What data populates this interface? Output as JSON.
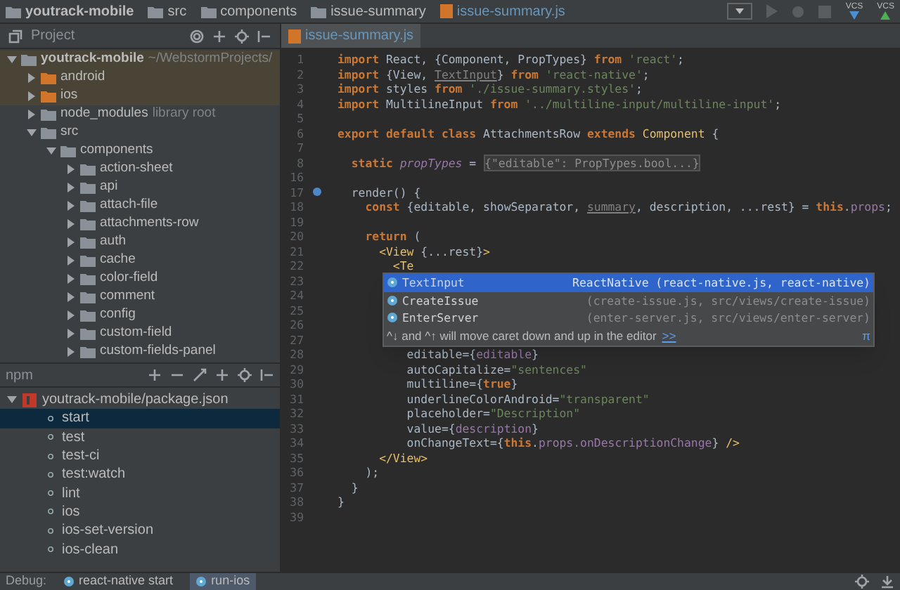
{
  "breadcrumbs": [
    {
      "label": "youtrack-mobile",
      "kind": "folder",
      "bold": true
    },
    {
      "label": "src",
      "kind": "folder",
      "bold": false
    },
    {
      "label": "components",
      "kind": "folder",
      "bold": false
    },
    {
      "label": "issue-summary",
      "kind": "folder",
      "bold": false
    },
    {
      "label": "issue-summary.js",
      "kind": "file",
      "bold": false
    }
  ],
  "toolbar": {
    "vcs_labels": [
      "VCS",
      "VCS"
    ]
  },
  "project_panel": {
    "title": "Project",
    "tree": [
      {
        "label": "youtrack-mobile",
        "hint": "~/WebstormProjects/",
        "expanded": true,
        "tinted": true,
        "bold": true,
        "color": "#8a9199",
        "children": [
          {
            "label": "android",
            "expanded": false,
            "tinted": true,
            "bold": false,
            "color": "#d0752a"
          },
          {
            "label": "ios",
            "expanded": false,
            "tinted": true,
            "bold": false,
            "color": "#d0752a"
          },
          {
            "label": "node_modules",
            "hint": "library root",
            "expanded": false,
            "tinted": false,
            "bold": false,
            "color": "#8a9199"
          },
          {
            "label": "src",
            "expanded": true,
            "tinted": false,
            "bold": false,
            "color": "#8a9199",
            "children": [
              {
                "label": "components",
                "expanded": true,
                "tinted": false,
                "bold": false,
                "color": "#8a9199",
                "children": [
                  {
                    "label": "action-sheet",
                    "expanded": false,
                    "tinted": false,
                    "bold": false,
                    "color": "#8a9199"
                  },
                  {
                    "label": "api",
                    "expanded": false,
                    "tinted": false,
                    "bold": false,
                    "color": "#8a9199"
                  },
                  {
                    "label": "attach-file",
                    "expanded": false,
                    "tinted": false,
                    "bold": false,
                    "color": "#8a9199"
                  },
                  {
                    "label": "attachments-row",
                    "expanded": false,
                    "tinted": false,
                    "bold": false,
                    "color": "#8a9199"
                  },
                  {
                    "label": "auth",
                    "expanded": false,
                    "tinted": false,
                    "bold": false,
                    "color": "#8a9199"
                  },
                  {
                    "label": "cache",
                    "expanded": false,
                    "tinted": false,
                    "bold": false,
                    "color": "#8a9199"
                  },
                  {
                    "label": "color-field",
                    "expanded": false,
                    "tinted": false,
                    "bold": false,
                    "color": "#8a9199"
                  },
                  {
                    "label": "comment",
                    "expanded": false,
                    "tinted": false,
                    "bold": false,
                    "color": "#8a9199"
                  },
                  {
                    "label": "config",
                    "expanded": false,
                    "tinted": false,
                    "bold": false,
                    "color": "#8a9199"
                  },
                  {
                    "label": "custom-field",
                    "expanded": false,
                    "tinted": false,
                    "bold": false,
                    "color": "#8a9199"
                  },
                  {
                    "label": "custom-fields-panel",
                    "expanded": false,
                    "tinted": false,
                    "bold": false,
                    "color": "#8a9199"
                  }
                ]
              }
            ]
          }
        ]
      }
    ]
  },
  "npm_panel": {
    "title": "npm",
    "package": {
      "label": "youtrack-mobile/package.json",
      "expanded": true,
      "scripts": [
        {
          "label": "start",
          "selected": true
        },
        {
          "label": "test",
          "selected": false
        },
        {
          "label": "test-ci",
          "selected": false
        },
        {
          "label": "test:watch",
          "selected": false
        },
        {
          "label": "lint",
          "selected": false
        },
        {
          "label": "ios",
          "selected": false
        },
        {
          "label": "ios-set-version",
          "selected": false
        },
        {
          "label": "ios-clean",
          "selected": false
        }
      ]
    }
  },
  "editor": {
    "tab": "issue-summary.js",
    "lines": [
      {
        "num": "1",
        "tokens": [
          {
            "kind": "kw",
            "text": "import"
          },
          {
            "kind": "plain",
            "text": " React, {Component, PropTypes} "
          },
          {
            "kind": "kw",
            "text": "from"
          },
          {
            "kind": "str",
            "text": " 'react'"
          },
          {
            "kind": "plain",
            "text": ";"
          }
        ]
      },
      {
        "num": "2",
        "tokens": [
          {
            "kind": "kw",
            "text": "import"
          },
          {
            "kind": "plain",
            "text": " {View, "
          },
          {
            "kind": "unused",
            "text": "TextInput"
          },
          {
            "kind": "plain",
            "text": "} "
          },
          {
            "kind": "kw",
            "text": "from"
          },
          {
            "kind": "str",
            "text": " 'react-native'"
          },
          {
            "kind": "plain",
            "text": ";"
          }
        ]
      },
      {
        "num": "3",
        "tokens": [
          {
            "kind": "kw",
            "text": "import"
          },
          {
            "kind": "plain",
            "text": " styles "
          },
          {
            "kind": "kw",
            "text": "from"
          },
          {
            "kind": "str",
            "text": " './issue-summary.styles'"
          },
          {
            "kind": "plain",
            "text": ";"
          }
        ]
      },
      {
        "num": "4",
        "tokens": [
          {
            "kind": "kw",
            "text": "import"
          },
          {
            "kind": "plain",
            "text": " MultilineInput "
          },
          {
            "kind": "kw",
            "text": "from"
          },
          {
            "kind": "str",
            "text": " '../multiline-input/multiline-input'"
          },
          {
            "kind": "plain",
            "text": ";"
          }
        ]
      },
      {
        "num": "5"
      },
      {
        "num": "6",
        "tokens": [
          {
            "kind": "kw",
            "text": "export default class"
          },
          {
            "kind": "plain",
            "text": " AttachmentsRow "
          },
          {
            "kind": "kw",
            "text": "extends "
          },
          {
            "kind": "tag",
            "text": "Component"
          },
          {
            "kind": "plain",
            "text": " {"
          }
        ]
      },
      {
        "num": "7"
      },
      {
        "num": "8",
        "tokens": [
          {
            "kind": "kw",
            "text": "  static "
          },
          {
            "kind": "field",
            "text": "propTypes"
          },
          {
            "kind": "plain",
            "text": " = "
          },
          {
            "kind": "folded",
            "text": "{\"editable\": PropTypes.bool...}"
          }
        ]
      },
      {
        "num": "16"
      },
      {
        "num": "17",
        "marker": true,
        "tokens": [
          {
            "kind": "plain",
            "text": "  render() {"
          }
        ]
      },
      {
        "num": "18",
        "tokens": [
          {
            "kind": "kw",
            "text": "    const"
          },
          {
            "kind": "plain",
            "text": " {editable, showSeparator, "
          },
          {
            "kind": "unused",
            "text": "summary"
          },
          {
            "kind": "plain",
            "text": ", description, ...rest} = "
          },
          {
            "kind": "kw",
            "text": "this"
          },
          {
            "kind": "plain",
            "text": "."
          },
          {
            "kind": "prop",
            "text": "props"
          },
          {
            "kind": "plain",
            "text": ";"
          }
        ]
      },
      {
        "num": "19"
      },
      {
        "num": "20",
        "tokens": [
          {
            "kind": "kw",
            "text": "    return"
          },
          {
            "kind": "plain",
            "text": " ("
          }
        ]
      },
      {
        "num": "21",
        "tokens": [
          {
            "kind": "tag",
            "text": "      <View"
          },
          {
            "kind": "plain",
            "text": " {...rest}"
          },
          {
            "kind": "tag",
            "text": ">"
          }
        ]
      },
      {
        "num": "22",
        "tokens": [
          {
            "kind": "tag",
            "text": "        <Te"
          }
        ]
      },
      {
        "num": "23"
      },
      {
        "num": "24"
      },
      {
        "num": "25"
      },
      {
        "num": "26"
      },
      {
        "num": "27"
      },
      {
        "num": "28",
        "tokens": [
          {
            "kind": "plain",
            "text": "          editable={"
          },
          {
            "kind": "prop",
            "text": "editable"
          },
          {
            "kind": "plain",
            "text": "}"
          }
        ]
      },
      {
        "num": "29",
        "tokens": [
          {
            "kind": "plain",
            "text": "          autoCapitalize="
          },
          {
            "kind": "str",
            "text": "\"sentences\""
          }
        ]
      },
      {
        "num": "30",
        "tokens": [
          {
            "kind": "plain",
            "text": "          multiline={"
          },
          {
            "kind": "kw",
            "text": "true"
          },
          {
            "kind": "plain",
            "text": "}"
          }
        ]
      },
      {
        "num": "31",
        "tokens": [
          {
            "kind": "plain",
            "text": "          underlineColorAndroid="
          },
          {
            "kind": "str",
            "text": "\"transparent\""
          }
        ]
      },
      {
        "num": "32",
        "tokens": [
          {
            "kind": "plain",
            "text": "          placeholder="
          },
          {
            "kind": "str",
            "text": "\"Description\""
          }
        ]
      },
      {
        "num": "33",
        "tokens": [
          {
            "kind": "plain",
            "text": "          value={"
          },
          {
            "kind": "prop",
            "text": "description"
          },
          {
            "kind": "plain",
            "text": "}"
          }
        ]
      },
      {
        "num": "34",
        "tokens": [
          {
            "kind": "plain",
            "text": "          onChangeText={"
          },
          {
            "kind": "kw",
            "text": "this"
          },
          {
            "kind": "plain",
            "text": "."
          },
          {
            "kind": "prop",
            "text": "props.onDescriptionChange"
          },
          {
            "kind": "plain",
            "text": "} "
          },
          {
            "kind": "tag",
            "text": "/>"
          }
        ]
      },
      {
        "num": "35",
        "tokens": [
          {
            "kind": "tag",
            "text": "      </View>"
          }
        ]
      },
      {
        "num": "36",
        "tokens": [
          {
            "kind": "plain",
            "text": "    );"
          }
        ]
      },
      {
        "num": "37",
        "tokens": [
          {
            "kind": "plain",
            "text": "  }"
          }
        ]
      },
      {
        "num": "38",
        "tokens": [
          {
            "kind": "plain",
            "text": "}"
          }
        ]
      },
      {
        "num": "39"
      }
    ],
    "completion": {
      "items": [
        {
          "name": "TextInput",
          "detail": "ReactNative (react-native.js, react-native)",
          "selected": true
        },
        {
          "name": "CreateIssue",
          "detail": "(create-issue.js, src/views/create-issue)",
          "selected": false
        },
        {
          "name": "EnterServer",
          "detail": "(enter-server.js, src/views/enter-server)",
          "selected": false
        }
      ],
      "hint": "^↓ and ^↑ will move caret down and up in the editor",
      "hint_link": ">>",
      "pi": "π"
    }
  },
  "status_bar": {
    "label": "Debug:",
    "tabs": [
      {
        "label": "react-native start",
        "selected": false
      },
      {
        "label": "run-ios",
        "selected": true
      }
    ]
  }
}
